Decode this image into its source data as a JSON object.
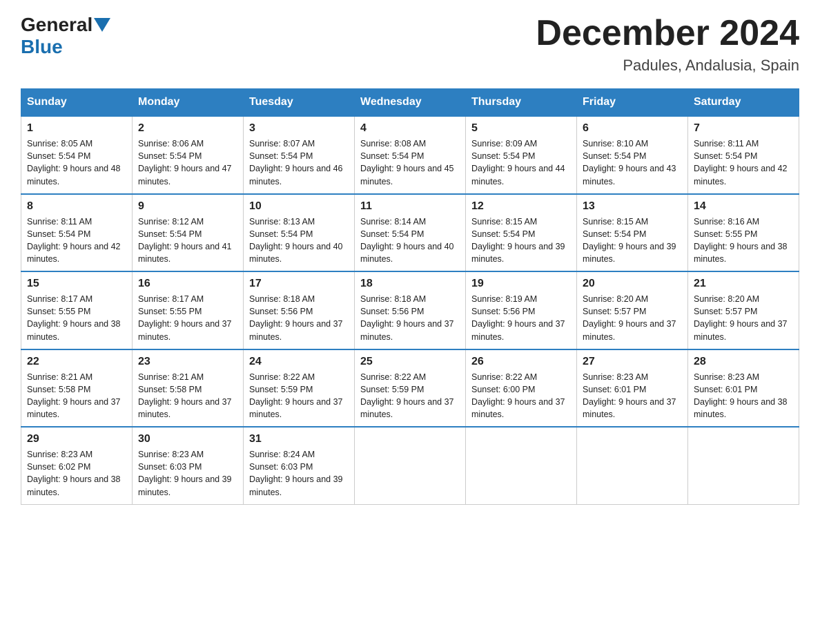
{
  "header": {
    "logo_general": "General",
    "logo_blue": "Blue",
    "title": "December 2024",
    "subtitle": "Padules, Andalusia, Spain"
  },
  "days_of_week": [
    "Sunday",
    "Monday",
    "Tuesday",
    "Wednesday",
    "Thursday",
    "Friday",
    "Saturday"
  ],
  "weeks": [
    [
      {
        "day": "1",
        "sunrise": "8:05 AM",
        "sunset": "5:54 PM",
        "daylight": "9 hours and 48 minutes."
      },
      {
        "day": "2",
        "sunrise": "8:06 AM",
        "sunset": "5:54 PM",
        "daylight": "9 hours and 47 minutes."
      },
      {
        "day": "3",
        "sunrise": "8:07 AM",
        "sunset": "5:54 PM",
        "daylight": "9 hours and 46 minutes."
      },
      {
        "day": "4",
        "sunrise": "8:08 AM",
        "sunset": "5:54 PM",
        "daylight": "9 hours and 45 minutes."
      },
      {
        "day": "5",
        "sunrise": "8:09 AM",
        "sunset": "5:54 PM",
        "daylight": "9 hours and 44 minutes."
      },
      {
        "day": "6",
        "sunrise": "8:10 AM",
        "sunset": "5:54 PM",
        "daylight": "9 hours and 43 minutes."
      },
      {
        "day": "7",
        "sunrise": "8:11 AM",
        "sunset": "5:54 PM",
        "daylight": "9 hours and 42 minutes."
      }
    ],
    [
      {
        "day": "8",
        "sunrise": "8:11 AM",
        "sunset": "5:54 PM",
        "daylight": "9 hours and 42 minutes."
      },
      {
        "day": "9",
        "sunrise": "8:12 AM",
        "sunset": "5:54 PM",
        "daylight": "9 hours and 41 minutes."
      },
      {
        "day": "10",
        "sunrise": "8:13 AM",
        "sunset": "5:54 PM",
        "daylight": "9 hours and 40 minutes."
      },
      {
        "day": "11",
        "sunrise": "8:14 AM",
        "sunset": "5:54 PM",
        "daylight": "9 hours and 40 minutes."
      },
      {
        "day": "12",
        "sunrise": "8:15 AM",
        "sunset": "5:54 PM",
        "daylight": "9 hours and 39 minutes."
      },
      {
        "day": "13",
        "sunrise": "8:15 AM",
        "sunset": "5:54 PM",
        "daylight": "9 hours and 39 minutes."
      },
      {
        "day": "14",
        "sunrise": "8:16 AM",
        "sunset": "5:55 PM",
        "daylight": "9 hours and 38 minutes."
      }
    ],
    [
      {
        "day": "15",
        "sunrise": "8:17 AM",
        "sunset": "5:55 PM",
        "daylight": "9 hours and 38 minutes."
      },
      {
        "day": "16",
        "sunrise": "8:17 AM",
        "sunset": "5:55 PM",
        "daylight": "9 hours and 37 minutes."
      },
      {
        "day": "17",
        "sunrise": "8:18 AM",
        "sunset": "5:56 PM",
        "daylight": "9 hours and 37 minutes."
      },
      {
        "day": "18",
        "sunrise": "8:18 AM",
        "sunset": "5:56 PM",
        "daylight": "9 hours and 37 minutes."
      },
      {
        "day": "19",
        "sunrise": "8:19 AM",
        "sunset": "5:56 PM",
        "daylight": "9 hours and 37 minutes."
      },
      {
        "day": "20",
        "sunrise": "8:20 AM",
        "sunset": "5:57 PM",
        "daylight": "9 hours and 37 minutes."
      },
      {
        "day": "21",
        "sunrise": "8:20 AM",
        "sunset": "5:57 PM",
        "daylight": "9 hours and 37 minutes."
      }
    ],
    [
      {
        "day": "22",
        "sunrise": "8:21 AM",
        "sunset": "5:58 PM",
        "daylight": "9 hours and 37 minutes."
      },
      {
        "day": "23",
        "sunrise": "8:21 AM",
        "sunset": "5:58 PM",
        "daylight": "9 hours and 37 minutes."
      },
      {
        "day": "24",
        "sunrise": "8:22 AM",
        "sunset": "5:59 PM",
        "daylight": "9 hours and 37 minutes."
      },
      {
        "day": "25",
        "sunrise": "8:22 AM",
        "sunset": "5:59 PM",
        "daylight": "9 hours and 37 minutes."
      },
      {
        "day": "26",
        "sunrise": "8:22 AM",
        "sunset": "6:00 PM",
        "daylight": "9 hours and 37 minutes."
      },
      {
        "day": "27",
        "sunrise": "8:23 AM",
        "sunset": "6:01 PM",
        "daylight": "9 hours and 37 minutes."
      },
      {
        "day": "28",
        "sunrise": "8:23 AM",
        "sunset": "6:01 PM",
        "daylight": "9 hours and 38 minutes."
      }
    ],
    [
      {
        "day": "29",
        "sunrise": "8:23 AM",
        "sunset": "6:02 PM",
        "daylight": "9 hours and 38 minutes."
      },
      {
        "day": "30",
        "sunrise": "8:23 AM",
        "sunset": "6:03 PM",
        "daylight": "9 hours and 39 minutes."
      },
      {
        "day": "31",
        "sunrise": "8:24 AM",
        "sunset": "6:03 PM",
        "daylight": "9 hours and 39 minutes."
      },
      null,
      null,
      null,
      null
    ]
  ]
}
